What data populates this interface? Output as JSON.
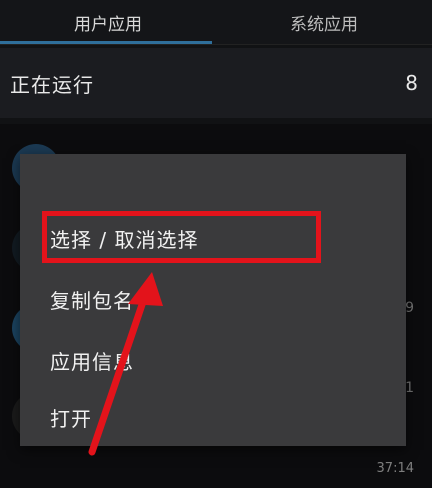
{
  "tabs": [
    {
      "label": "用户应用",
      "active": true
    },
    {
      "label": "系统应用",
      "active": false
    }
  ],
  "running": {
    "title": "正在运行",
    "count": "8"
  },
  "background_list": {
    "meta_1": "9",
    "meta_2": "1",
    "time": "37:14"
  },
  "context_menu": {
    "items": [
      {
        "label": "选择 / 取消选择"
      },
      {
        "label": "复制包名"
      },
      {
        "label": "应用信息"
      },
      {
        "label": "打开"
      }
    ]
  },
  "colors": {
    "background": "#111214",
    "menu_bg": "#3a3a3c",
    "accent": "#2f6f9b",
    "annotation_red": "#e3131b"
  }
}
